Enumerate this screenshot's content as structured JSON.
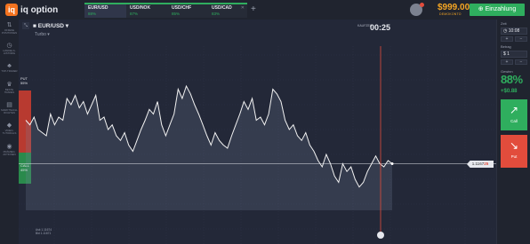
{
  "app": {
    "logo_mark": "iq",
    "logo_text": "iq option"
  },
  "tabs": [
    {
      "name": "EUR/USD",
      "pct": "88%"
    },
    {
      "name": "USD/NOK",
      "pct": "87%"
    },
    {
      "name": "USD/CHF",
      "pct": "85%"
    },
    {
      "name": "USD/CAD",
      "pct": "83%"
    }
  ],
  "add_tab_label": "+",
  "account": {
    "balance": "$999.00",
    "balance_label": "DEMOKONTO",
    "deposit_label": "Einzahlung"
  },
  "sidebar": [
    {
      "icon": "⇅",
      "label": "OFFENE POSITIONEN"
    },
    {
      "icon": "◷",
      "label": "HANDELS-HISTORIE"
    },
    {
      "icon": "♣",
      "label": "TOP-TRADER"
    },
    {
      "icon": "♛",
      "label": "BESTE TRADES"
    },
    {
      "icon": "▤",
      "label": "MARKTNACH-RICHTEN"
    },
    {
      "icon": "◆",
      "label": "VIDEO-TUTORIALS"
    },
    {
      "icon": "◉",
      "label": "PRÄMIEN-AKTIONEN"
    }
  ],
  "asset": {
    "name": "EUR/USD",
    "type": "Turbo",
    "zoom": "⤡"
  },
  "timer": {
    "label": "KAUFZEIT",
    "value": "00:25"
  },
  "sentiment": {
    "put_label": "PUT",
    "put_pct": "55%",
    "call_label": "CALL",
    "call_pct": "45%"
  },
  "price": {
    "main": "1.1167",
    "last_digits": "25"
  },
  "bottom_info": {
    "line1": "Ask 1.11674",
    "line2": "Bid 1.11671"
  },
  "right_panel": {
    "time_label": "Zeit",
    "time_value": "10:08",
    "amount_label": "Betrag",
    "amount_value": "$ 1",
    "profit_label": "Gewinn",
    "profit_pct": "88%",
    "profit_abs": "+$0.88",
    "call_label": "Call",
    "put_label": "Put",
    "plus": "+",
    "minus": "−"
  },
  "colors": {
    "up": "#2fae5e",
    "down": "#e24c3c",
    "accent": "#f5a623",
    "line": "#f2f2f2"
  },
  "chart_data": {
    "type": "line",
    "y": [
      0.58,
      0.55,
      0.6,
      0.52,
      0.5,
      0.48,
      0.62,
      0.55,
      0.6,
      0.58,
      0.72,
      0.68,
      0.74,
      0.66,
      0.7,
      0.62,
      0.68,
      0.74,
      0.58,
      0.6,
      0.52,
      0.55,
      0.48,
      0.45,
      0.5,
      0.42,
      0.38,
      0.45,
      0.52,
      0.58,
      0.65,
      0.62,
      0.7,
      0.55,
      0.48,
      0.55,
      0.62,
      0.78,
      0.72,
      0.8,
      0.75,
      0.68,
      0.62,
      0.55,
      0.48,
      0.42,
      0.5,
      0.45,
      0.42,
      0.4,
      0.48,
      0.55,
      0.62,
      0.7,
      0.65,
      0.72,
      0.58,
      0.6,
      0.55,
      0.62,
      0.78,
      0.75,
      0.7,
      0.58,
      0.52,
      0.55,
      0.48,
      0.45,
      0.5,
      0.42,
      0.38,
      0.32,
      0.28,
      0.36,
      0.3,
      0.22,
      0.18,
      0.3,
      0.25,
      0.28,
      0.2,
      0.15,
      0.18,
      0.25,
      0.3,
      0.35,
      0.3,
      0.28,
      0.32,
      0.3
    ],
    "current_index": 89
  }
}
